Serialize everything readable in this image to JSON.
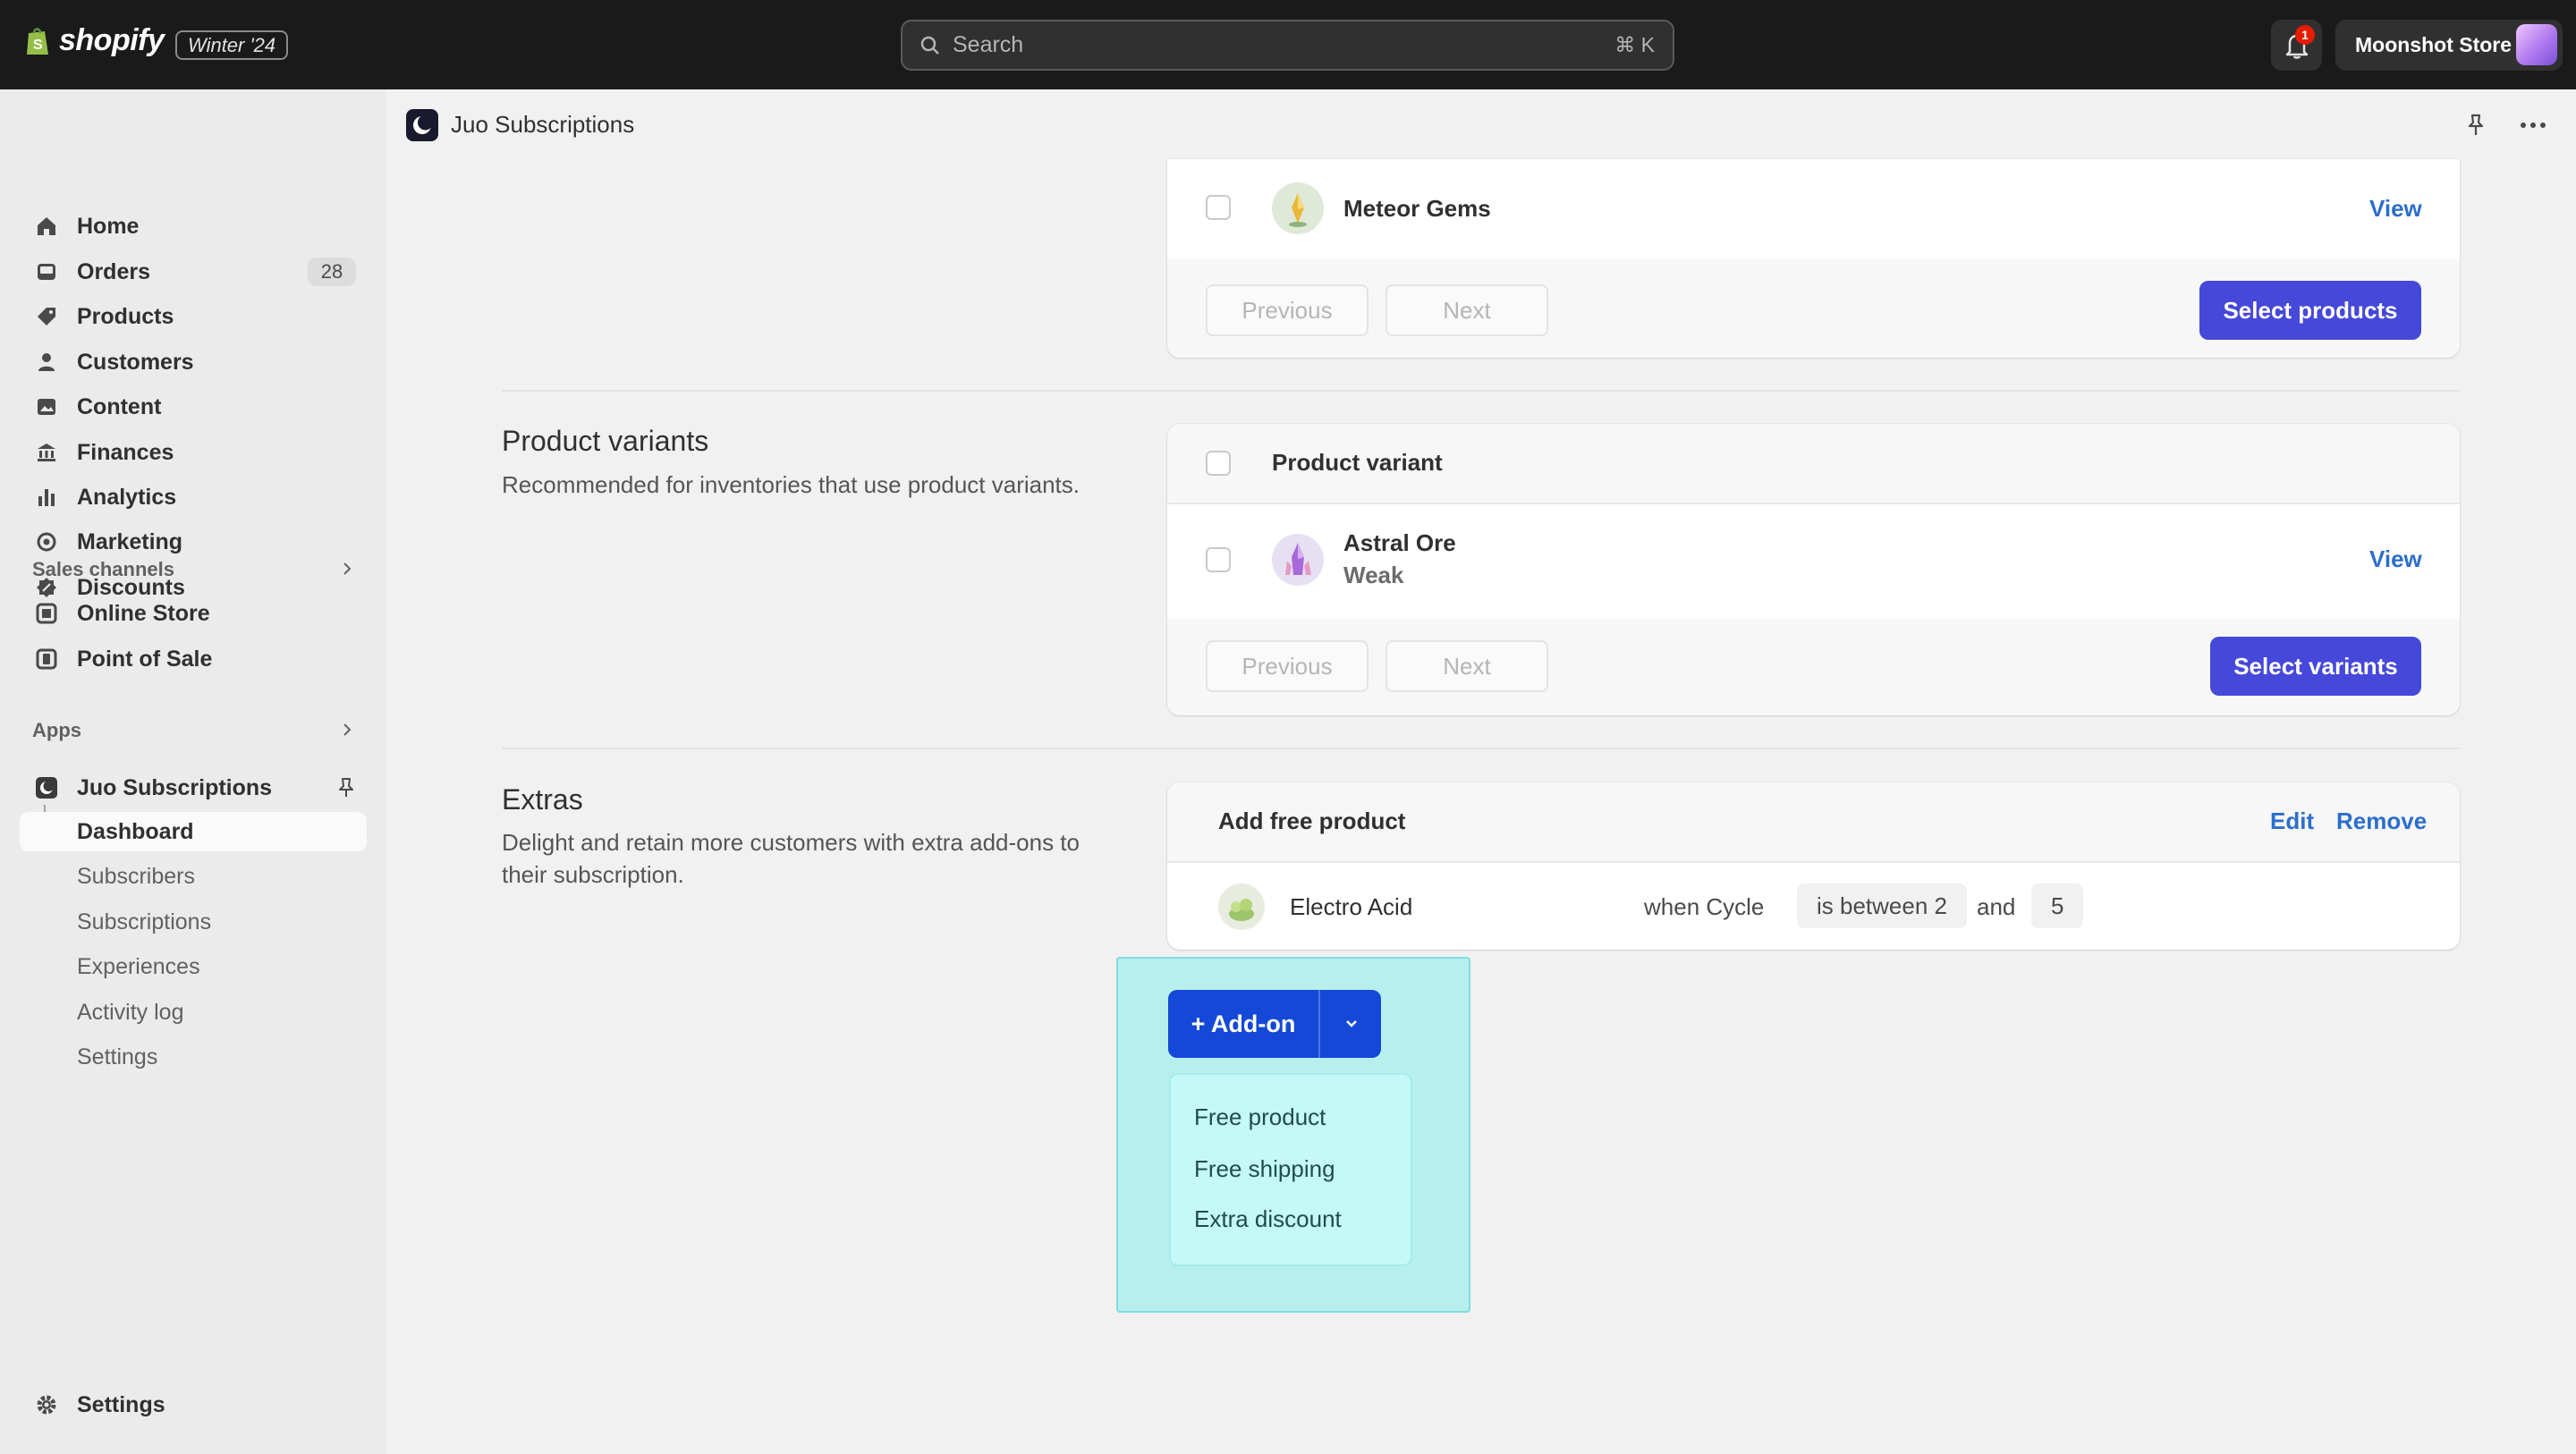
{
  "topbar": {
    "logo_text": "shopify",
    "edition": "Winter '24",
    "search_placeholder": "Search",
    "search_shortcut": "⌘ K",
    "notification_count": "1",
    "store_name": "Moonshot Store"
  },
  "sidebar": {
    "items": [
      {
        "label": "Home",
        "icon": "home-icon"
      },
      {
        "label": "Orders",
        "icon": "inbox-icon",
        "count": "28"
      },
      {
        "label": "Products",
        "icon": "tag-icon"
      },
      {
        "label": "Customers",
        "icon": "person-icon"
      },
      {
        "label": "Content",
        "icon": "image-icon"
      },
      {
        "label": "Finances",
        "icon": "bank-icon"
      },
      {
        "label": "Analytics",
        "icon": "bar-chart-icon"
      },
      {
        "label": "Marketing",
        "icon": "target-icon"
      },
      {
        "label": "Discounts",
        "icon": "discount-icon"
      }
    ],
    "sales_channels_label": "Sales channels",
    "sales_channels": [
      {
        "label": "Online Store",
        "icon": "store-icon"
      },
      {
        "label": "Point of Sale",
        "icon": "pos-icon"
      }
    ],
    "apps_label": "Apps",
    "app": {
      "label": "Juo Subscriptions",
      "subitems": [
        "Dashboard",
        "Subscribers",
        "Subscriptions",
        "Experiences",
        "Activity log",
        "Settings"
      ],
      "active_subitem": "Dashboard"
    },
    "settings_label": "Settings"
  },
  "appbar": {
    "title": "Juo Subscriptions"
  },
  "products_card": {
    "row": {
      "title": "Meteor Gems",
      "action": "View"
    },
    "previous": "Previous",
    "next": "Next",
    "select_button": "Select products"
  },
  "variants_section": {
    "title": "Product variants",
    "description": "Recommended for inventories that use product variants.",
    "header": "Product variant",
    "row": {
      "title": "Astral Ore",
      "subtitle": "Weak",
      "action": "View"
    },
    "previous": "Previous",
    "next": "Next",
    "select_button": "Select variants"
  },
  "extras_section": {
    "title": "Extras",
    "description": "Delight and retain more customers with extra add-ons to their subscription.",
    "card_title": "Add free product",
    "edit": "Edit",
    "remove": "Remove",
    "product": "Electro Acid",
    "when": "when Cycle",
    "condition": "is between 2",
    "and": "and",
    "value": "5"
  },
  "addon": {
    "button": "+ Add-on",
    "menu": [
      "Free product",
      "Free shipping",
      "Extra discount"
    ]
  },
  "colors": {
    "primary": "#4548d8",
    "addon_button": "#1448d6",
    "link": "#2c6ecb",
    "highlight": "#b7efee"
  }
}
